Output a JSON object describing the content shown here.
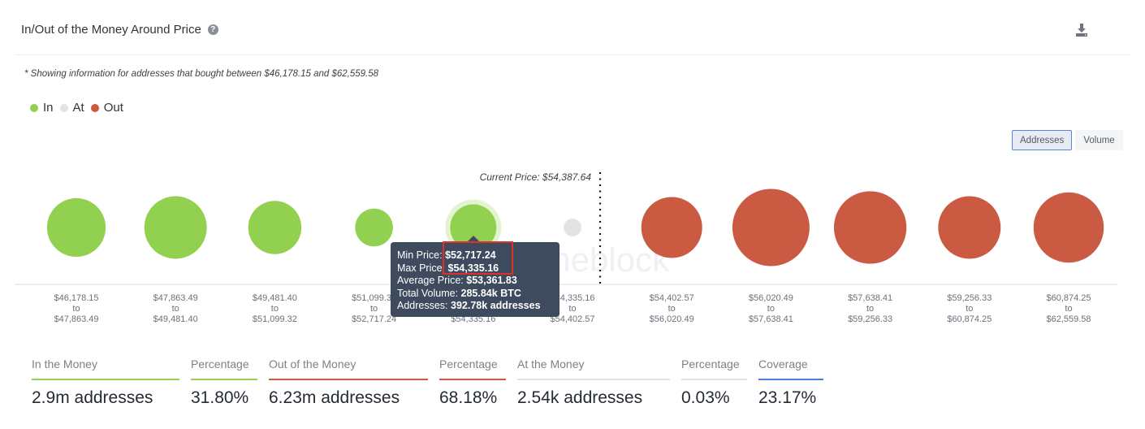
{
  "header": {
    "title": "In/Out of the Money Around Price",
    "help_icon": "question-circle-icon",
    "download_icon": "download-icon"
  },
  "note": "* Showing information for addresses that bought between $46,178.15 and $62,559.58",
  "legend": [
    {
      "label": "In",
      "color": "#92d050"
    },
    {
      "label": "At",
      "color": "#e3e3e3"
    },
    {
      "label": "Out",
      "color": "#cb5a42"
    }
  ],
  "toggle": {
    "options": [
      "Addresses",
      "Volume"
    ],
    "selected": "Addresses"
  },
  "watermark": "intotheblock",
  "chart_data": {
    "type": "scatter",
    "title": "In/Out of the Money Around Price",
    "current_price_label": "Current Price: $54,387.64",
    "current_price": 54387.64,
    "size_metric": "addresses",
    "categories": [
      {
        "from": "$46,178.15",
        "to": "$47,863.49",
        "status": "in",
        "relative_size": 0.76
      },
      {
        "from": "$47,863.49",
        "to": "$49,481.40",
        "status": "in",
        "relative_size": 0.81
      },
      {
        "from": "$49,481.40",
        "to": "$51,099.32",
        "status": "in",
        "relative_size": 0.69
      },
      {
        "from": "$51,099.32",
        "to": "$52,717.24",
        "status": "in",
        "relative_size": 0.49
      },
      {
        "from": "$52,717.24",
        "to": "$54,335.16",
        "status": "in",
        "relative_size": 0.6,
        "highlighted": true
      },
      {
        "from": "$54,335.16",
        "to": "$54,402.57",
        "status": "at",
        "relative_size": 0.23
      },
      {
        "from": "$54,402.57",
        "to": "$56,020.49",
        "status": "out",
        "relative_size": 0.79
      },
      {
        "from": "$56,020.49",
        "to": "$57,638.41",
        "status": "out",
        "relative_size": 1.0
      },
      {
        "from": "$57,638.41",
        "to": "$59,256.33",
        "status": "out",
        "relative_size": 0.94
      },
      {
        "from": "$59,256.33",
        "to": "$60,874.25",
        "status": "out",
        "relative_size": 0.81
      },
      {
        "from": "$60,874.25",
        "to": "$62,559.58",
        "status": "out",
        "relative_size": 0.91
      }
    ],
    "range_connector": "to",
    "colors": {
      "in": "#92d050",
      "at": "#e3e3e3",
      "out": "#cb5a42",
      "halo": "#e4f3d2"
    }
  },
  "tooltip": {
    "rows": [
      {
        "label": "Min Price:",
        "value": "$52,717.24"
      },
      {
        "label": "Max Price:",
        "value": "$54,335.16"
      },
      {
        "label": "Average Price:",
        "value": "$53,361.83"
      },
      {
        "label": "Total Volume:",
        "value": "285.84k BTC"
      },
      {
        "label": "Addresses:",
        "value": "392.78k addresses"
      }
    ]
  },
  "stats": [
    {
      "label": "In the Money",
      "value": "2.9m addresses",
      "color": "#92d050"
    },
    {
      "label": "Percentage",
      "value": "31.80%",
      "color": "#92d050"
    },
    {
      "label": "Out of the Money",
      "value": "6.23m addresses",
      "color": "#cb5a42"
    },
    {
      "label": "Percentage",
      "value": "68.18%",
      "color": "#cb5a42"
    },
    {
      "label": "At the Money",
      "value": "2.54k addresses",
      "color": "#e3e3e3"
    },
    {
      "label": "Percentage",
      "value": "0.03%",
      "color": "#e3e3e3"
    },
    {
      "label": "Coverage",
      "value": "23.17%",
      "color": "#4a7de0"
    }
  ]
}
